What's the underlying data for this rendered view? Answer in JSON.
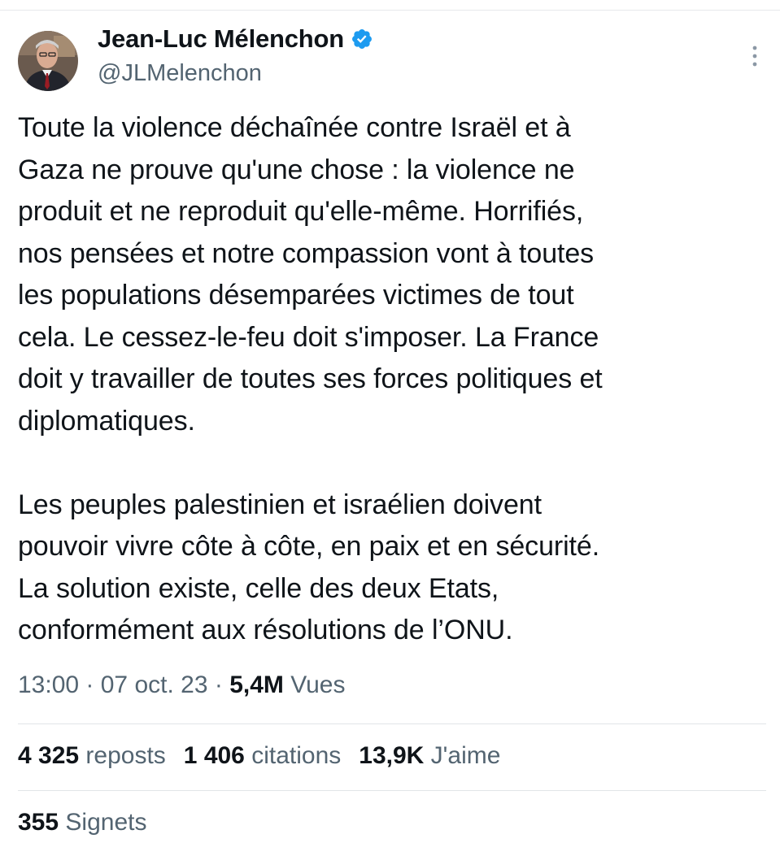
{
  "author": {
    "name": "Jean-Luc Mélenchon",
    "handle": "@JLMelenchon",
    "verified": true,
    "avatar_icon": "avatar-photo",
    "verified_icon": "verified-badge-icon",
    "verified_color": "#1d9bf0"
  },
  "tweet": {
    "text": "Toute la violence déchaînée contre Israël et à\nGaza ne prouve qu'une chose : la violence ne\nproduit et ne reproduit qu'elle-même. Horrifiés,\nnos pensées et notre compassion vont à toutes\nles populations désemparées victimes de tout\ncela. Le cessez-le-feu doit s'imposer. La France\ndoit y travailler de toutes ses forces politiques et\ndiplomatiques.\n\nLes peuples palestinien et israélien doivent\npouvoir vivre côte à côte, en paix et en sécurité.\nLa solution existe, celle des deux Etats,\nconformément aux résolutions de l’ONU."
  },
  "meta": {
    "time": "13:00",
    "separator": " · ",
    "date": "07 oct. 23",
    "views_count": "5,4M",
    "views_label": " Vues"
  },
  "stats": {
    "reposts_count": "4 325",
    "reposts_label": " reposts",
    "quotes_count": "1 406",
    "quotes_label": " citations",
    "likes_count": "13,9K",
    "likes_label": " J'aime",
    "bookmarks_count": "355",
    "bookmarks_label": " Signets"
  },
  "colors": {
    "text": "#0f1419",
    "secondary": "#536471",
    "divider": "#e1e5e8"
  }
}
